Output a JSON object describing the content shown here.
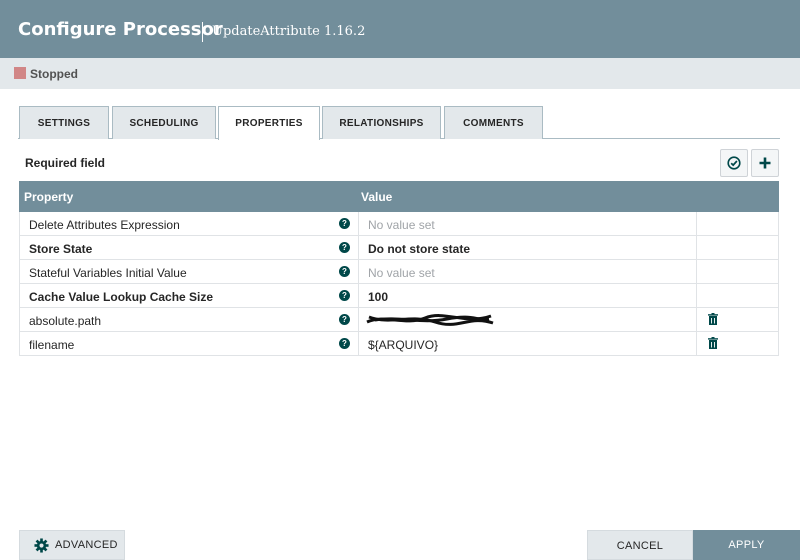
{
  "header": {
    "title": "Configure Processor",
    "subtitle": "UpdateAttribute 1.16.2"
  },
  "status": {
    "label": "Stopped",
    "color": "#d18686"
  },
  "tabs": [
    {
      "label": "SETTINGS",
      "active": false
    },
    {
      "label": "SCHEDULING",
      "active": false
    },
    {
      "label": "PROPERTIES",
      "active": true
    },
    {
      "label": "RELATIONSHIPS",
      "active": false
    },
    {
      "label": "COMMENTS",
      "active": false
    }
  ],
  "properties": {
    "required_label": "Required field",
    "columns": {
      "property": "Property",
      "value": "Value"
    },
    "rows": [
      {
        "name": "Delete Attributes Expression",
        "value": "No value set",
        "required": false,
        "value_set": false,
        "deletable": false
      },
      {
        "name": "Store State",
        "value": "Do not store state",
        "required": true,
        "value_set": true,
        "deletable": false
      },
      {
        "name": "Stateful Variables Initial Value",
        "value": "No value set",
        "required": false,
        "value_set": false,
        "deletable": false
      },
      {
        "name": "Cache Value Lookup Cache Size",
        "value": "100",
        "required": true,
        "value_set": true,
        "deletable": false
      },
      {
        "name": "absolute.path",
        "value": "",
        "required": false,
        "value_set": true,
        "deletable": true,
        "redacted": true
      },
      {
        "name": "filename",
        "value": "${ARQUIVO}",
        "required": false,
        "value_set": true,
        "deletable": true
      }
    ]
  },
  "footer": {
    "advanced_label": "ADVANCED",
    "cancel_label": "CANCEL",
    "apply_label": "APPLY"
  },
  "colors": {
    "header": "#728e9b",
    "accent": "#004849",
    "status_bar": "#e3e8eb"
  }
}
